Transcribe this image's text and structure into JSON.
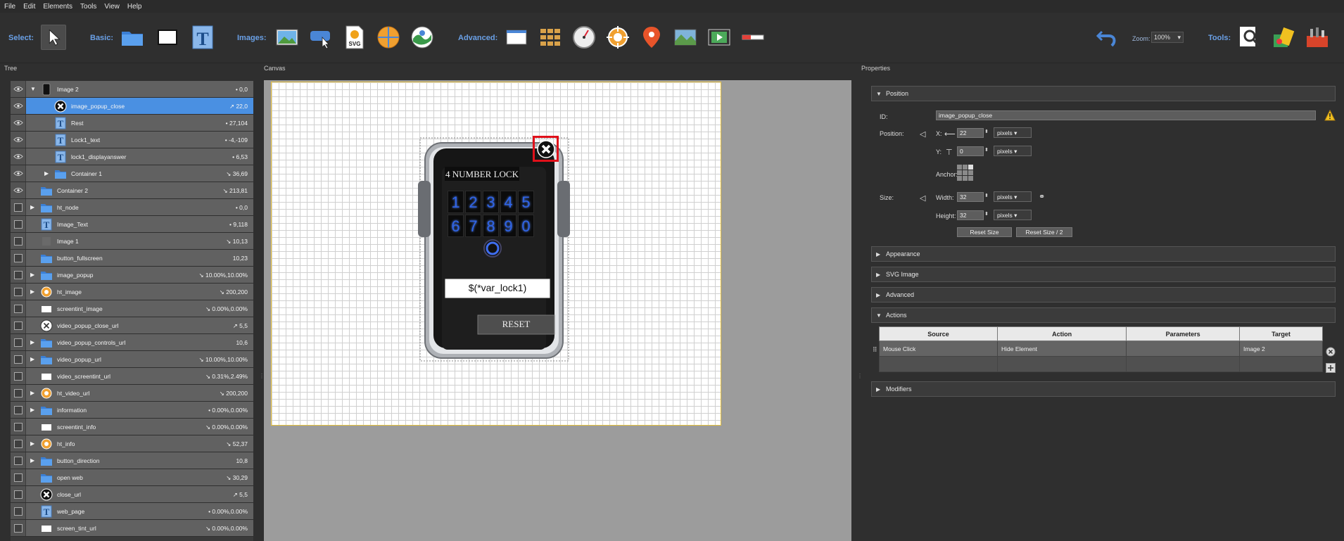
{
  "menu": [
    "File",
    "Edit",
    "Elements",
    "Tools",
    "View",
    "Help"
  ],
  "toolbar": {
    "select_label": "Select:",
    "basic_label": "Basic:",
    "images_label": "Images:",
    "advanced_label": "Advanced:",
    "zoom_label": "Zoom:",
    "zoom_value": "100%",
    "tools_label": "Tools:"
  },
  "panels": {
    "tree": "Tree",
    "canvas": "Canvas",
    "properties": "Properties"
  },
  "tree": [
    {
      "name": "Image 2",
      "val": "• 0,0",
      "vis": true,
      "icon": "phone-icon",
      "toggle": "open",
      "indent": 0
    },
    {
      "name": "image_popup_close",
      "val": "↗ 22,0",
      "vis": true,
      "icon": "close-circle-icon",
      "indent": 1,
      "selected": true
    },
    {
      "name": "Rest",
      "val": "• 27,104",
      "vis": true,
      "icon": "text-icon",
      "indent": 1
    },
    {
      "name": "Lock1_text",
      "val": "• -4,-109",
      "vis": true,
      "icon": "text-icon",
      "indent": 1
    },
    {
      "name": "lock1_displayanswer",
      "val": "• 6,53",
      "vis": true,
      "icon": "text-icon",
      "indent": 1
    },
    {
      "name": "Container 1",
      "val": "↘ 36,69",
      "vis": true,
      "icon": "folder-icon",
      "toggle": "closed",
      "indent": 1
    },
    {
      "name": "Container 2",
      "val": "↘ 213,81",
      "vis": true,
      "icon": "folder-icon",
      "indent": 0
    },
    {
      "name": "ht_node",
      "val": "• 0,0",
      "vis": false,
      "icon": "folder-icon",
      "toggle": "closed",
      "indent": 0
    },
    {
      "name": "Image_Text",
      "val": "• 9,118",
      "vis": false,
      "icon": "text-icon",
      "indent": 0
    },
    {
      "name": "Image 1",
      "val": "↘ 10,13",
      "vis": false,
      "icon": "blank-icon",
      "indent": 0
    },
    {
      "name": "button_fullscreen",
      "val": "10,23",
      "vis": false,
      "icon": "folder-icon",
      "indent": 0
    },
    {
      "name": "image_popup",
      "val": "↘ 10.00%,10.00%",
      "vis": false,
      "icon": "folder-icon",
      "toggle": "closed",
      "indent": 0
    },
    {
      "name": "ht_image",
      "val": "↘ 200,200",
      "vis": false,
      "icon": "hotspot-icon",
      "toggle": "closed",
      "indent": 0
    },
    {
      "name": "screentint_image",
      "val": "↘ 0.00%,0.00%",
      "vis": false,
      "icon": "white-rect-icon",
      "indent": 0
    },
    {
      "name": "video_popup_close_url",
      "val": "↗ 5,5",
      "vis": false,
      "icon": "close-outline-icon",
      "indent": 0
    },
    {
      "name": "video_popup_controls_url",
      "val": "10,6",
      "vis": false,
      "icon": "folder-icon",
      "toggle": "closed",
      "indent": 0
    },
    {
      "name": "video_popup_url",
      "val": "↘ 10.00%,10.00%",
      "vis": false,
      "icon": "folder-icon",
      "toggle": "closed",
      "indent": 0
    },
    {
      "name": "video_screentint_url",
      "val": "↘ 0.31%,2.49%",
      "vis": false,
      "icon": "white-rect-icon",
      "indent": 0
    },
    {
      "name": "ht_video_url",
      "val": "↘ 200,200",
      "vis": false,
      "icon": "hotspot-icon",
      "toggle": "closed",
      "indent": 0
    },
    {
      "name": "information",
      "val": "• 0.00%,0.00%",
      "vis": false,
      "icon": "folder-icon",
      "toggle": "closed",
      "indent": 0
    },
    {
      "name": "screentint_info",
      "val": "↘ 0.00%,0.00%",
      "vis": false,
      "icon": "white-rect-icon",
      "indent": 0
    },
    {
      "name": "ht_info",
      "val": "↘ 52,37",
      "vis": false,
      "icon": "hotspot-icon",
      "toggle": "closed",
      "indent": 0
    },
    {
      "name": "button_direction",
      "val": "10,8",
      "vis": false,
      "icon": "folder-icon",
      "toggle": "closed",
      "indent": 0
    },
    {
      "name": "open web",
      "val": "↘ 30,29",
      "vis": false,
      "icon": "folder-icon",
      "indent": 0
    },
    {
      "name": "close_url",
      "val": "↗ 5,5",
      "vis": false,
      "icon": "close-circle-icon",
      "indent": 0
    },
    {
      "name": "web_page",
      "val": "• 0.00%,0.00%",
      "vis": false,
      "icon": "text-icon",
      "indent": 0
    },
    {
      "name": "screen_tint_url",
      "val": "↘ 0.00%,0.00%",
      "vis": false,
      "icon": "white-rect-icon",
      "indent": 0
    }
  ],
  "lock": {
    "title": "4 NUMBER LOCK",
    "row1": [
      "1",
      "2",
      "3",
      "4",
      "5"
    ],
    "row2": [
      "6",
      "7",
      "8",
      "9",
      "0"
    ],
    "display": "$(*var_lock1)",
    "reset": "RESET"
  },
  "properties": {
    "position_title": "Position",
    "id_label": "ID:",
    "id_value": "image_popup_close",
    "position_label": "Position:",
    "x_label": "X:",
    "x_value": "22",
    "y_label": "Y:",
    "y_value": "0",
    "unit": "pixels",
    "anchor_label": "Anchor:",
    "size_label": "Size:",
    "width_label": "Width:",
    "width_value": "32",
    "height_label": "Height:",
    "height_value": "32",
    "reset_size": "Reset Size",
    "reset_size_half": "Reset Size / 2",
    "appearance": "Appearance",
    "svg_image": "SVG Image",
    "advanced": "Advanced",
    "actions": "Actions",
    "modifiers": "Modifiers"
  },
  "actions_table": {
    "headers": [
      "Source",
      "Action",
      "Parameters",
      "Target"
    ],
    "rows": [
      [
        "Mouse Click",
        "Hide Element",
        "",
        "Image 2"
      ]
    ]
  },
  "colors": {
    "accent": "#4a90e2",
    "label_blue": "#6aa0e6",
    "selection_red": "#e0101a"
  }
}
